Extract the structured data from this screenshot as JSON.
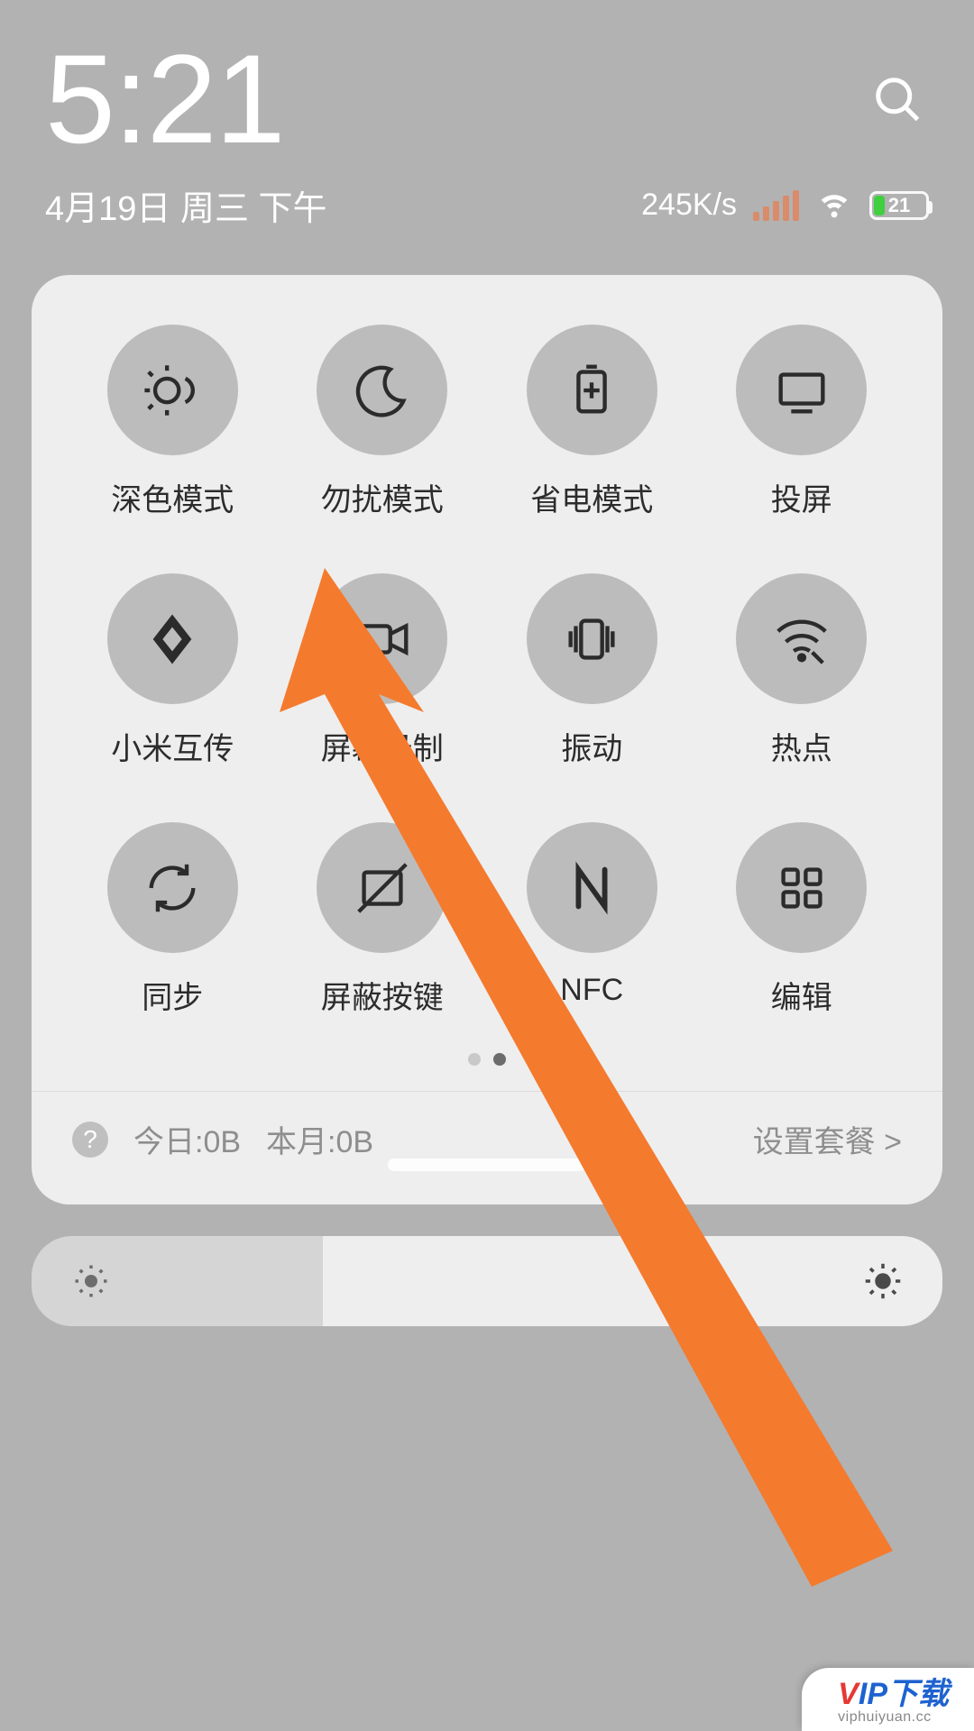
{
  "status": {
    "time": "5:21",
    "date": "4月19日 周三 下午",
    "net_speed": "245K/s",
    "battery_pct": 21,
    "battery_text": "21"
  },
  "tiles": [
    {
      "id": "dark-mode",
      "label": "深色模式"
    },
    {
      "id": "dnd",
      "label": "勿扰模式"
    },
    {
      "id": "battery-saver",
      "label": "省电模式"
    },
    {
      "id": "cast",
      "label": "投屏"
    },
    {
      "id": "mi-share",
      "label": "小米互传"
    },
    {
      "id": "screen-record",
      "label": "屏幕录制"
    },
    {
      "id": "vibrate",
      "label": "振动"
    },
    {
      "id": "hotspot",
      "label": "热点"
    },
    {
      "id": "sync",
      "label": "同步"
    },
    {
      "id": "block-keys",
      "label": "屏蔽按键"
    },
    {
      "id": "nfc",
      "label": "NFC"
    },
    {
      "id": "edit",
      "label": "编辑"
    }
  ],
  "pager": {
    "total": 2,
    "active": 1
  },
  "usage": {
    "today": "今日:0B",
    "month": "本月:0B",
    "plan_link": "设置套餐 >"
  },
  "brightness": {
    "value_pct": 32
  },
  "annotation": {
    "arrow_color": "#f47a2e",
    "target_tile": "screen-record"
  },
  "watermark": {
    "brand": "VIP下载",
    "url": "viphuiyuan.cc"
  }
}
